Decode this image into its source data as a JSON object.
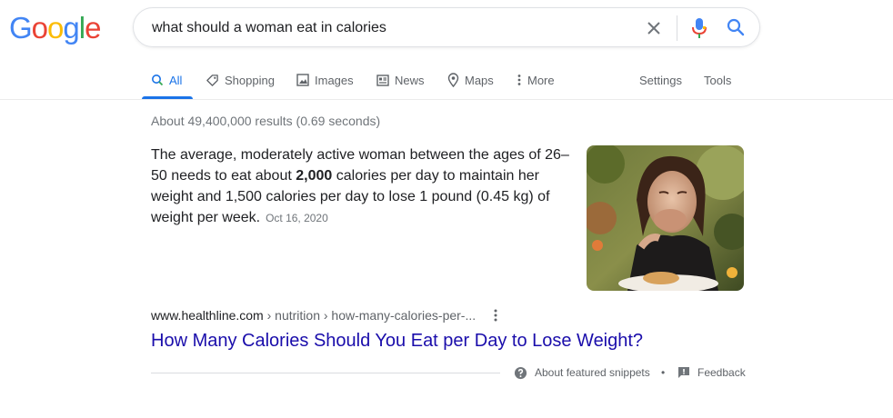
{
  "logo": {
    "letters": [
      "G",
      "o",
      "o",
      "g",
      "l",
      "e"
    ],
    "colors": [
      "#4285F4",
      "#EA4335",
      "#FBBC05",
      "#4285F4",
      "#34A853",
      "#EA4335"
    ]
  },
  "search": {
    "query": "what should a woman eat in calories"
  },
  "tabs": [
    {
      "label": "All",
      "icon": "search-icon",
      "active": true
    },
    {
      "label": "Shopping",
      "icon": "tag-icon"
    },
    {
      "label": "Images",
      "icon": "image-icon"
    },
    {
      "label": "News",
      "icon": "news-icon"
    },
    {
      "label": "Maps",
      "icon": "map-pin-icon"
    },
    {
      "label": "More",
      "icon": "more-vert-icon"
    }
  ],
  "tools": {
    "settings": "Settings",
    "tools": "Tools"
  },
  "stats": "About 49,400,000 results (0.69 seconds)",
  "snippet": {
    "text_before": "The average, moderately active woman between the ages of 26–50 needs to eat about ",
    "bold": "2,000",
    "text_after": " calories per day to maintain her weight and 1,500 calories per day to lose 1 pound (0.45 kg) of weight per week.",
    "date": "Oct 16, 2020"
  },
  "result": {
    "domain": "www.healthline.com",
    "breadcrumb": " › nutrition › how-many-calories-per-...",
    "title": "How Many Calories Should You Eat per Day to Lose Weight?"
  },
  "footer": {
    "about": "About featured snippets",
    "dot": "•",
    "feedback": "Feedback"
  },
  "colors": {
    "accent": "#1a73e8",
    "link": "#1a0dab",
    "muted": "#5f6368"
  }
}
